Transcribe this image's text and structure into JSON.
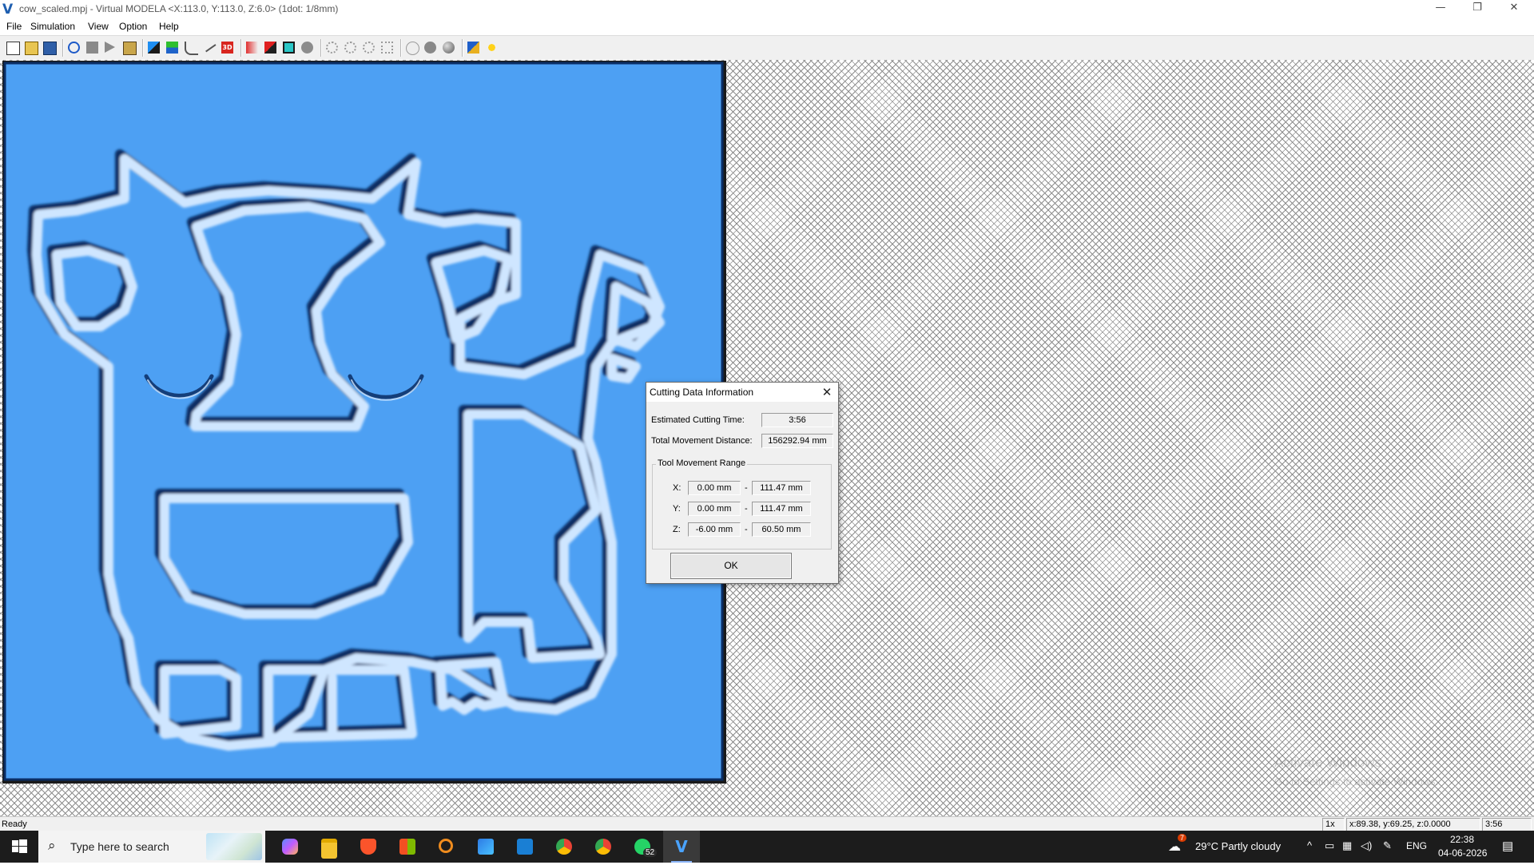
{
  "window": {
    "title": "cow_scaled.mpj - Virtual MODELA <X:113.0, Y:113.0, Z:6.0> (1dot: 1/8mm)",
    "app_icon": "V",
    "controls": {
      "minimize": "—",
      "restore": "❐",
      "close": "✕"
    }
  },
  "menu": [
    "File",
    "Simulation",
    "View",
    "Option",
    "Help"
  ],
  "toolbar_icons": [
    "new-icon",
    "open-icon",
    "save-icon",
    "rotate-icon",
    "stop-icon",
    "play-icon",
    "cutter-icon",
    "surface-icon",
    "contour-icon",
    "path-icon",
    "path-line-icon",
    "3d-view-icon",
    "color-icon",
    "material-icon",
    "frame-icon",
    "sphere-icon",
    "zoom-icon",
    "zoom-in-icon",
    "zoom-out-icon",
    "zoom-fit-icon",
    "shade-icon",
    "shade-solid-icon",
    "shade-smooth-icon",
    "settings-icon",
    "light-icon"
  ],
  "colors": {
    "model": "#4da0f3",
    "model_shadow": "#0a2d63",
    "model_highlight": "#cfe6ff"
  },
  "dialog": {
    "title": "Cutting Data Information",
    "close": "✕",
    "estimated_cutting_time_label": "Estimated Cutting Time:",
    "estimated_cutting_time": "3:56",
    "total_movement_label": "Total Movement Distance:",
    "total_movement": "156292.94 mm",
    "group_title": "Tool Movement Range",
    "range": {
      "x": {
        "label": "X:",
        "min": "0.00 mm",
        "max": "111.47 mm"
      },
      "y": {
        "label": "Y:",
        "min": "0.00 mm",
        "max": "111.47 mm"
      },
      "z": {
        "label": "Z:",
        "min": "-6.00 mm",
        "max": "60.50 mm"
      }
    },
    "dash": "-",
    "ok_label": "OK"
  },
  "status": {
    "text": "Ready",
    "zoom": "1x",
    "coords": "x:89.38, y:69.25, z:0.0000",
    "time": "3:56"
  },
  "watermark": {
    "line1": "Activate Windows",
    "line2": "Go to Settings to activate Windows."
  },
  "taskbar": {
    "search_placeholder": "Type here to search",
    "apps": [
      "copilot-icon",
      "file-explorer-icon",
      "brave-icon",
      "store-icon",
      "search-app-icon",
      "photos-icon",
      "vscode-icon",
      "chrome-icon",
      "chrome-profile-icon",
      "whatsapp-icon",
      "virtual-modela-icon"
    ],
    "whatsapp_badge": "52",
    "weather": "29°C  Partly cloudy",
    "weather_alert": "7",
    "language": "ENG",
    "time": "22:38",
    "date": "04-06-2026"
  }
}
